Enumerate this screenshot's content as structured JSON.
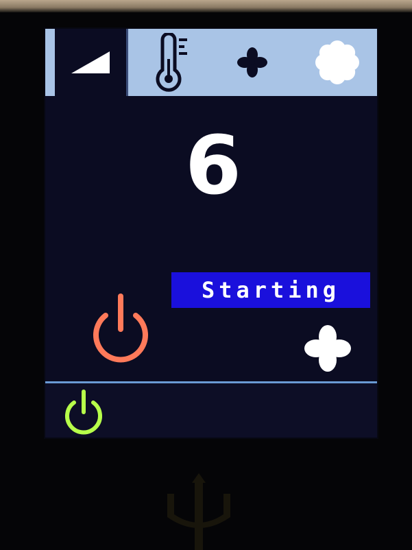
{
  "tabs": [
    {
      "id": "level",
      "icon": "level-ramp-icon",
      "active": true
    },
    {
      "id": "temperature",
      "icon": "thermometer-icon",
      "active": false
    },
    {
      "id": "fan",
      "icon": "fan-icon",
      "active": false
    },
    {
      "id": "settings",
      "icon": "flower-gear-icon",
      "active": false
    }
  ],
  "main": {
    "value": "6",
    "status": "Starting"
  },
  "icons": {
    "power_main": "power-icon",
    "fan_status": "fan-icon",
    "power_bottom": "power-icon",
    "brand_logo": "trident-logo-icon"
  },
  "colors": {
    "tabbar": "#a9c4e6",
    "screen_bg": "#0b0c22",
    "status_bg": "#1a10dc",
    "power_main": "#ff7a5a",
    "power_bottom": "#b7ff4a",
    "divider": "#6a9ad4"
  }
}
